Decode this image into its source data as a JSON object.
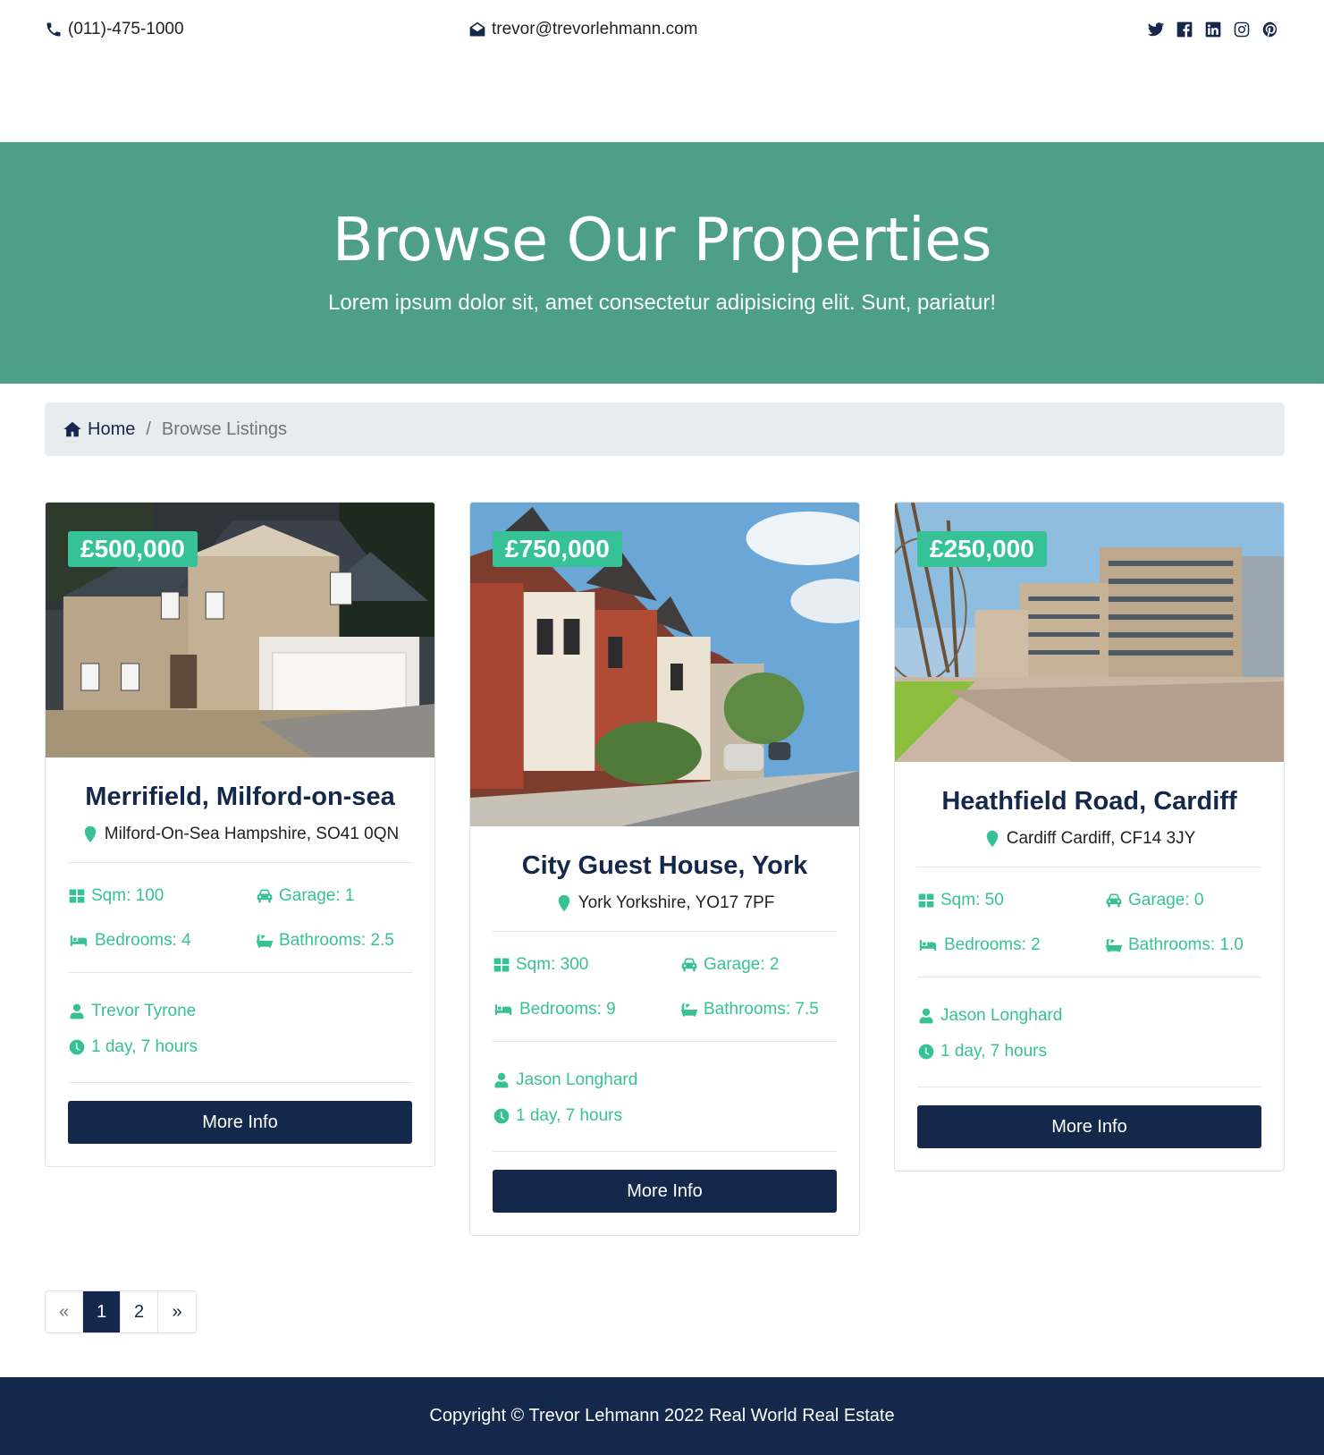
{
  "topbar": {
    "phone": "(011)-475-1000",
    "email": "trevor@trevorlehmann.com",
    "social": [
      "twitter-icon",
      "facebook-icon",
      "linkedin-icon",
      "instagram-icon",
      "pinterest-icon"
    ]
  },
  "hero": {
    "title": "Browse Our Properties",
    "subtitle": "Lorem ipsum dolor sit, amet consectetur adipisicing elit. Sunt, pariatur!"
  },
  "breadcrumb": {
    "home": "Home",
    "separator": "/",
    "current": "Browse Listings"
  },
  "listings": [
    {
      "price": "£500,000",
      "title": "Merrifield, Milford-on-sea",
      "address": "Milford-On-Sea Hampshire, SO41 0QN",
      "sqm": "Sqm: 100",
      "garage": "Garage: 1",
      "bedrooms": "Bedrooms: 4",
      "bathrooms": "Bathrooms: 2.5",
      "realtor": "Trevor Tyrone",
      "listed": "1 day, 7 hours",
      "button": "More Info"
    },
    {
      "price": "£750,000",
      "title": "City Guest House, York",
      "address": "York Yorkshire, YO17 7PF",
      "sqm": "Sqm: 300",
      "garage": "Garage: 2",
      "bedrooms": "Bedrooms: 9",
      "bathrooms": "Bathrooms: 7.5",
      "realtor": "Jason Longhard",
      "listed": "1 day, 7 hours",
      "button": "More Info"
    },
    {
      "price": "£250,000",
      "title": "Heathfield Road, Cardiff",
      "address": "Cardiff Cardiff, CF14 3JY",
      "sqm": "Sqm: 50",
      "garage": "Garage: 0",
      "bedrooms": "Bedrooms: 2",
      "bathrooms": "Bathrooms: 1.0",
      "realtor": "Jason Longhard",
      "listed": "1 day, 7 hours",
      "button": "More Info"
    }
  ],
  "pagination": {
    "prev": "«",
    "pages": [
      "1",
      "2"
    ],
    "active": "1",
    "next": "»"
  },
  "footer": {
    "copyright": "Copyright © Trevor Lehmann 2022 Real World Real Estate"
  },
  "colors": {
    "navy": "#14284b",
    "hero_green": "#4d9f87",
    "accent_green": "#36c196"
  }
}
